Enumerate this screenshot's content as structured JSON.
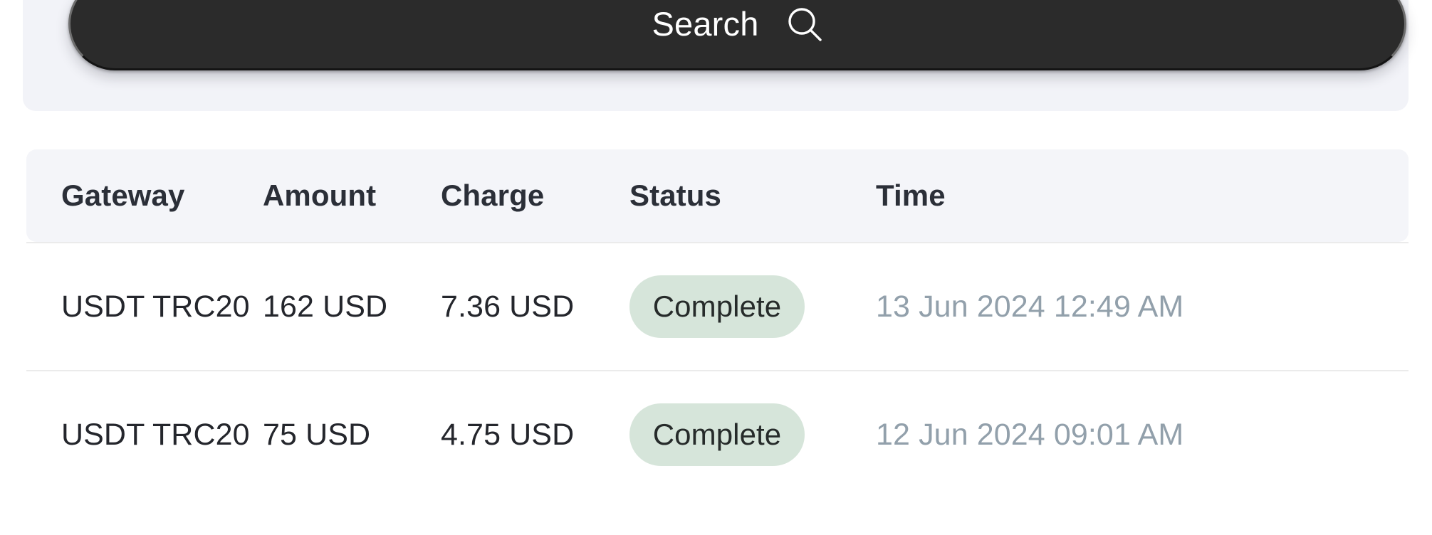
{
  "search": {
    "label": "Search",
    "icon": "search-icon",
    "background_color": "#2b2b2b",
    "text_color": "#ffffff"
  },
  "table": {
    "header_background": "#f4f5f9",
    "columns": [
      {
        "key": "gateway",
        "label": "Gateway"
      },
      {
        "key": "amount",
        "label": "Amount"
      },
      {
        "key": "charge",
        "label": "Charge"
      },
      {
        "key": "status",
        "label": "Status"
      },
      {
        "key": "time",
        "label": "Time"
      }
    ],
    "rows": [
      {
        "gateway": "USDT TRC20",
        "amount": "162 USD",
        "charge": "7.36 USD",
        "status": "Complete",
        "status_color": "#d6e5da",
        "time": "13 Jun 2024 12:49 AM"
      },
      {
        "gateway": "USDT TRC20",
        "amount": "75 USD",
        "charge": "4.75 USD",
        "status": "Complete",
        "status_color": "#d6e5da",
        "time": "12 Jun 2024 09:01 AM"
      }
    ]
  }
}
